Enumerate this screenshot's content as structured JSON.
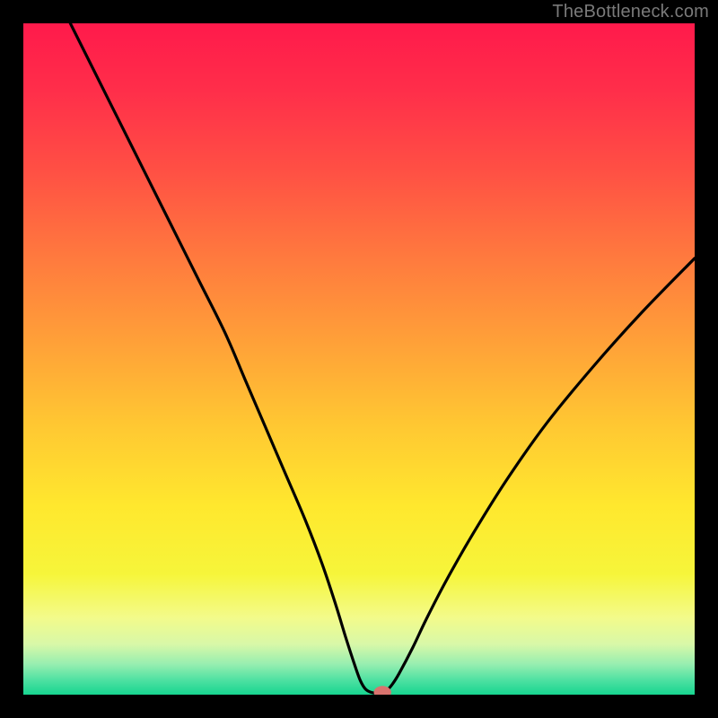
{
  "watermark": "TheBottleneck.com",
  "gradient": {
    "stops": [
      {
        "offset": 0.0,
        "color": "#ff1a4b"
      },
      {
        "offset": 0.1,
        "color": "#ff2e4a"
      },
      {
        "offset": 0.22,
        "color": "#ff5044"
      },
      {
        "offset": 0.35,
        "color": "#ff7a3e"
      },
      {
        "offset": 0.48,
        "color": "#ffa238"
      },
      {
        "offset": 0.6,
        "color": "#ffc832"
      },
      {
        "offset": 0.72,
        "color": "#ffe82e"
      },
      {
        "offset": 0.82,
        "color": "#f6f53a"
      },
      {
        "offset": 0.885,
        "color": "#f3fb8a"
      },
      {
        "offset": 0.925,
        "color": "#d8f8a8"
      },
      {
        "offset": 0.955,
        "color": "#96eeb0"
      },
      {
        "offset": 0.978,
        "color": "#4fe1a2"
      },
      {
        "offset": 1.0,
        "color": "#17d590"
      }
    ]
  },
  "chart_data": {
    "type": "line",
    "title": "",
    "xlabel": "",
    "ylabel": "",
    "xlim": [
      0,
      100
    ],
    "ylim": [
      0,
      100
    ],
    "grid": false,
    "legend": false,
    "series": [
      {
        "name": "bottleneck-curve",
        "x": [
          7,
          10,
          14,
          18,
          22,
          26,
          30,
          33,
          36,
          39,
          42,
          44.5,
          46.5,
          48,
          49.3,
          50.2,
          51,
          52,
          53.2,
          54.2,
          55,
          56,
          58,
          60,
          63,
          67,
          72,
          78,
          85,
          92,
          100
        ],
        "y": [
          100,
          94,
          86,
          78,
          70,
          62,
          54,
          47,
          40,
          33,
          26,
          19.5,
          13.5,
          8.6,
          4.6,
          2.1,
          0.8,
          0.3,
          0.3,
          0.7,
          1.6,
          3.2,
          7.0,
          11.2,
          17.0,
          24.0,
          32.0,
          40.5,
          49.0,
          56.8,
          65.0
        ]
      }
    ],
    "marker": {
      "x": 53.5,
      "y": 0.35,
      "rx": 1.3,
      "ry": 0.95
    },
    "annotations": []
  }
}
